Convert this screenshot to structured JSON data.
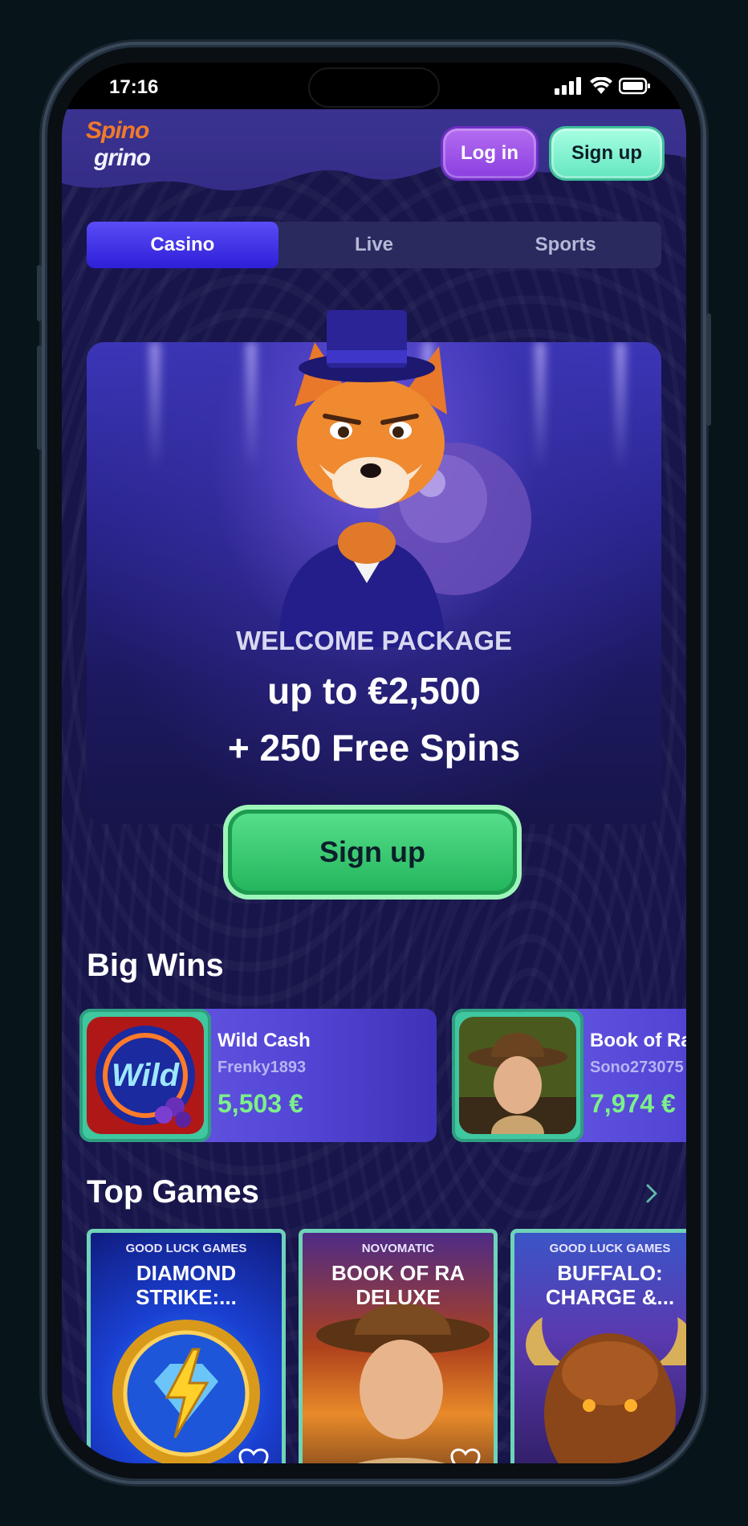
{
  "status_bar": {
    "time": "17:16"
  },
  "brand": {
    "logo_line1": "Spino",
    "logo_line2": "grino"
  },
  "header": {
    "login_label": "Log in",
    "signup_label": "Sign up"
  },
  "tabs": [
    {
      "label": "Casino",
      "active": true
    },
    {
      "label": "Live",
      "active": false
    },
    {
      "label": "Sports",
      "active": false
    }
  ],
  "hero": {
    "title": "WELCOME PACKAGE",
    "amount": "up to €2,500",
    "spins": "+ 250 Free Spins",
    "cta_label": "Sign up"
  },
  "big_wins": {
    "title": "Big Wins",
    "items": [
      {
        "game": "Wild Cash",
        "user": "Frenky1893",
        "amount": "5,503 €",
        "thumb_text": "Wild"
      },
      {
        "game": "Book of Ra",
        "user": "Sono273075",
        "amount": "7,974 €"
      }
    ]
  },
  "top_games": {
    "title": "Top Games",
    "items": [
      {
        "provider": "GOOD LUCK GAMES",
        "name": "DIAMOND STRIKE:..."
      },
      {
        "provider": "NOVOMATIC",
        "name": "BOOK OF RA DELUXE"
      },
      {
        "provider": "GOOD LUCK GAMES",
        "name": "BUFFALO: CHARGE &..."
      }
    ]
  },
  "colors": {
    "background": "#17154a",
    "accent_tab": "#3f2fe6",
    "signup_green": "#3fd07a",
    "mint": "#7ff0cc",
    "purple_button": "#9d55e8",
    "win_amount": "#7cf08a",
    "logo_orange": "#f07a2a"
  },
  "icons": [
    "signal-icon",
    "wifi-icon",
    "battery-icon",
    "chevron-right-icon",
    "heart-icon"
  ]
}
